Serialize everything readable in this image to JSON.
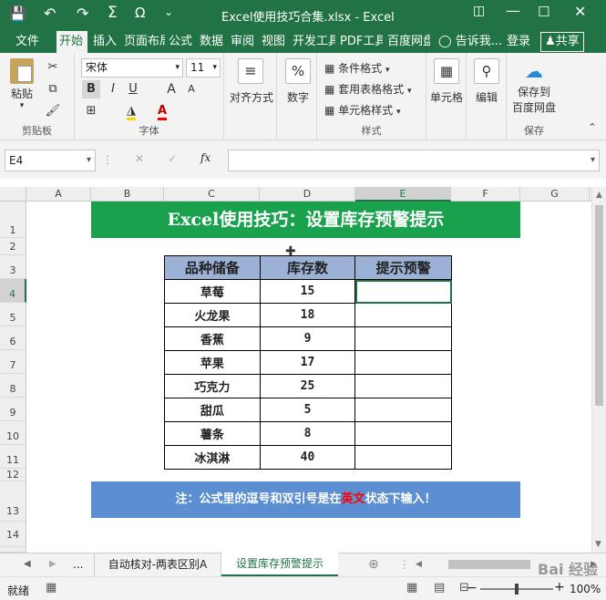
{
  "window": {
    "title": "Excel使用技巧合集.xlsx - Excel"
  },
  "tabs": [
    "文件",
    "开始",
    "插入",
    "页面布局",
    "公式",
    "数据",
    "审阅",
    "视图",
    "开发工具",
    "PDF工具",
    "百度网盘"
  ],
  "tell_me": "告诉我...",
  "login": "登录",
  "share": "共享",
  "ribbon": {
    "clipboard": {
      "paste": "粘贴",
      "label": "剪贴板"
    },
    "font": {
      "name": "宋体",
      "size": "11",
      "label": "字体",
      "bold": "B",
      "italic": "I",
      "underline": "U",
      "grow": "A",
      "shrink": "A",
      "font_color": "A"
    },
    "align": {
      "label": "对齐方式"
    },
    "number": {
      "label": "数字"
    },
    "styles": {
      "cond": "条件格式",
      "table": "套用表格格式",
      "cell": "单元格样式",
      "label": "样式"
    },
    "cells": {
      "label": "单元格"
    },
    "edit": {
      "label": "编辑"
    },
    "save": {
      "line1": "保存到",
      "line2": "百度网盘",
      "label": "保存"
    }
  },
  "formula_bar": {
    "cell_ref": "E4",
    "fx": "fx",
    "value": ""
  },
  "columns": [
    "A",
    "B",
    "C",
    "D",
    "E",
    "F",
    "G"
  ],
  "rows": [
    "1",
    "2",
    "3",
    "4",
    "5",
    "6",
    "7",
    "8",
    "9",
    "10",
    "11",
    "12",
    "13",
    "14"
  ],
  "banner": {
    "title": "Excel使用技巧：设置库存预警提示"
  },
  "table": {
    "headers": [
      "品种储备",
      "库存数",
      "提示预警"
    ],
    "rows": [
      {
        "name": "草莓",
        "qty": "15",
        "warn": ""
      },
      {
        "name": "火龙果",
        "qty": "18",
        "warn": ""
      },
      {
        "name": "香蕉",
        "qty": "9",
        "warn": ""
      },
      {
        "name": "苹果",
        "qty": "17",
        "warn": ""
      },
      {
        "name": "巧克力",
        "qty": "25",
        "warn": ""
      },
      {
        "name": "甜瓜",
        "qty": "5",
        "warn": ""
      },
      {
        "name": "薯条",
        "qty": "8",
        "warn": ""
      },
      {
        "name": "冰淇淋",
        "qty": "40",
        "warn": ""
      }
    ]
  },
  "note": {
    "prefix": "注：公式里的逗号和双引号是在",
    "highlight": "英文",
    "suffix": "状态下输入！"
  },
  "sheet_tabs": {
    "ellipsis": "...",
    "tab1": "自动核对-两表区别A",
    "tab2": "设置库存预警提示"
  },
  "status": {
    "ready": "就绪",
    "zoom": "100%"
  },
  "watermark": "Bai 经验",
  "colors": {
    "accent": "#217346",
    "banner": "#1aa14e",
    "note_bar": "#5b8fd1",
    "header_fill": "#9bb2d6",
    "highlight": "#ff0000"
  }
}
